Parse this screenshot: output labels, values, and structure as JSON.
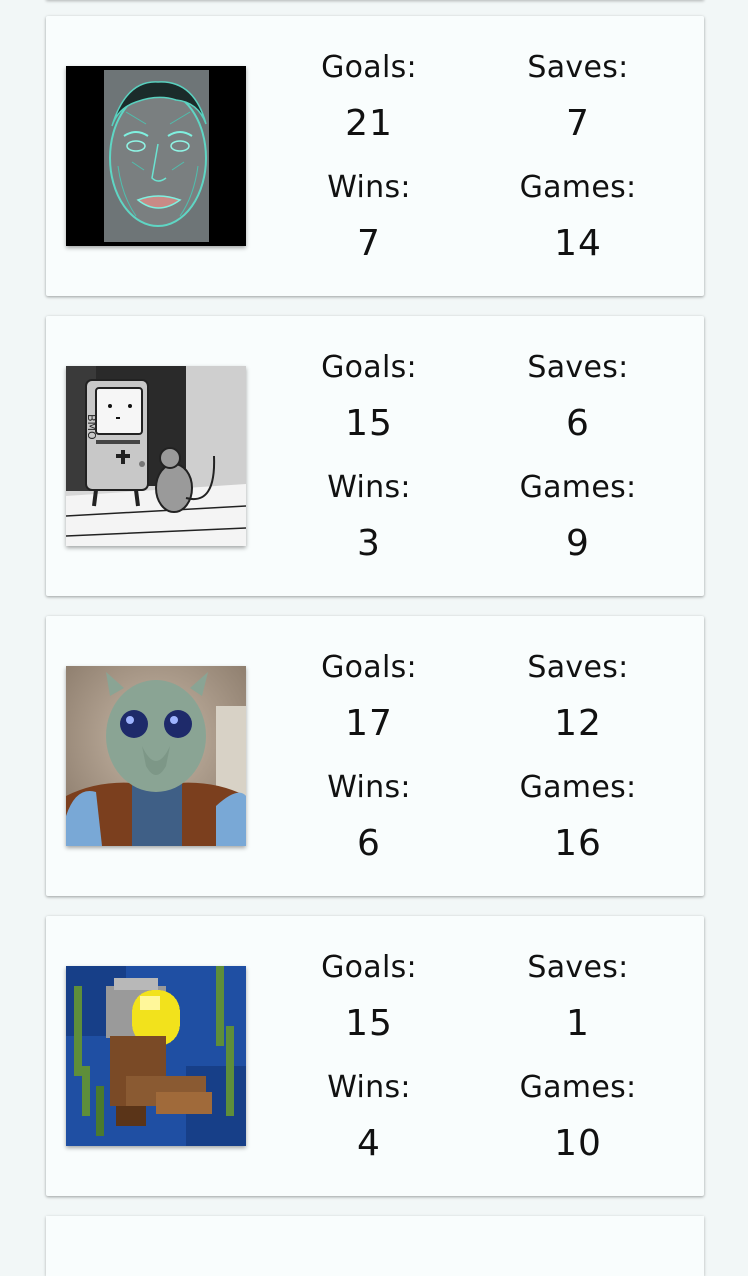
{
  "labels": {
    "goals": "Goals:",
    "saves": "Saves:",
    "wins": "Wins:",
    "games": "Games:"
  },
  "players": [
    {
      "avatar_icon": "sketch-face-avatar-icon",
      "goals": "21",
      "saves": "7",
      "wins": "7",
      "games": "14"
    },
    {
      "avatar_icon": "bmo-cartoon-avatar-icon",
      "goals": "15",
      "saves": "6",
      "wins": "3",
      "games": "9"
    },
    {
      "avatar_icon": "lego-alien-avatar-icon",
      "goals": "17",
      "saves": "12",
      "wins": "6",
      "games": "16"
    },
    {
      "avatar_icon": "pixel-diver-avatar-icon",
      "goals": "15",
      "saves": "1",
      "wins": "4",
      "games": "10"
    }
  ],
  "colors": {
    "page_background": "#f2f7f7",
    "card_background": "#f9fdfd",
    "text": "#111111"
  }
}
